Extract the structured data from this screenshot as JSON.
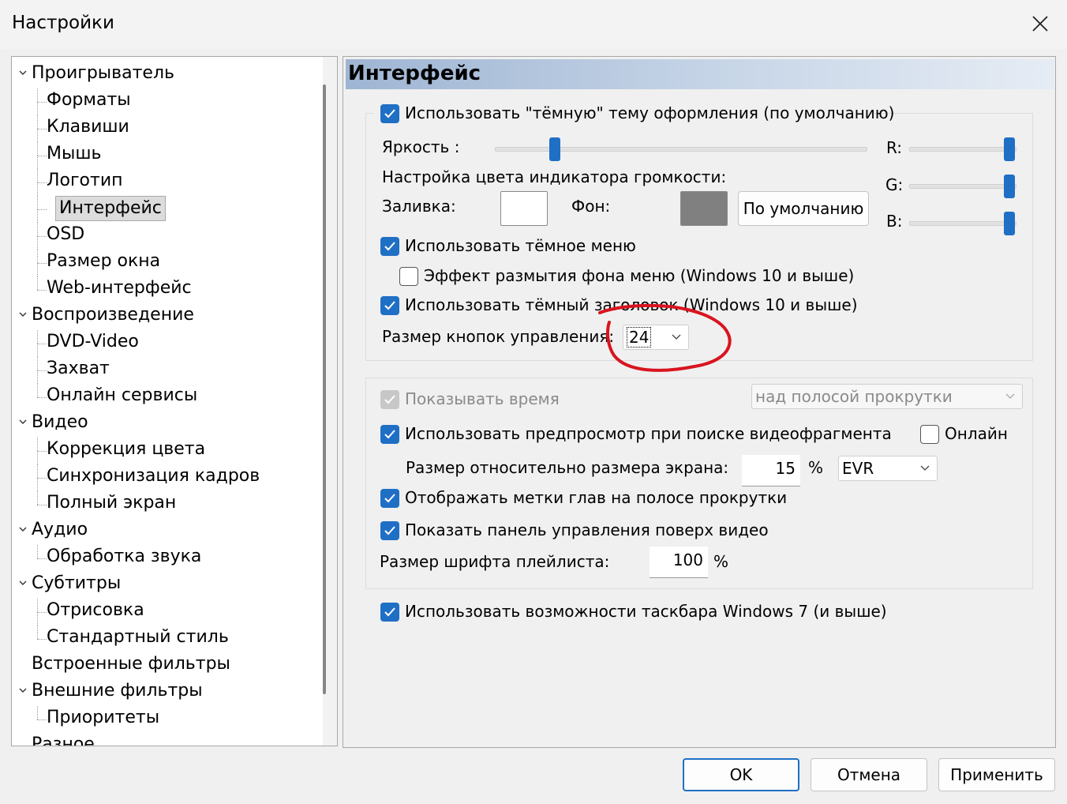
{
  "window": {
    "title": "Настройки"
  },
  "tree": {
    "items": [
      {
        "label": "Проигрыватель"
      },
      {
        "label": "Форматы"
      },
      {
        "label": "Клавиши"
      },
      {
        "label": "Мышь"
      },
      {
        "label": "Логотип"
      },
      {
        "label": "Интерфейс"
      },
      {
        "label": "OSD"
      },
      {
        "label": "Размер окна"
      },
      {
        "label": "Web-интерфейс"
      },
      {
        "label": "Воспроизведение"
      },
      {
        "label": "DVD-Video"
      },
      {
        "label": "Захват"
      },
      {
        "label": "Онлайн сервисы"
      },
      {
        "label": "Видео"
      },
      {
        "label": "Коррекция цвета"
      },
      {
        "label": "Синхронизация кадров"
      },
      {
        "label": "Полный экран"
      },
      {
        "label": "Аудио"
      },
      {
        "label": "Обработка звука"
      },
      {
        "label": "Субтитры"
      },
      {
        "label": "Отрисовка"
      },
      {
        "label": "Стандартный стиль"
      },
      {
        "label": "Встроенные фильтры"
      },
      {
        "label": "Внешние фильтры"
      },
      {
        "label": "Приоритеты"
      },
      {
        "label": "Разное"
      }
    ]
  },
  "page": {
    "header": "Интерфейс",
    "dark_theme": {
      "label": "Использовать \"тёмную\" тему оформления (по умолчанию)",
      "checked": true
    },
    "brightness_label": "Яркость :",
    "rgb": {
      "r": "R:",
      "g": "G:",
      "b": "B:"
    },
    "volume_color_label": "Настройка цвета индикатора громкости:",
    "fill_label": "Заливка:",
    "bg_label": "Фон:",
    "fill_color": "#ffffff",
    "bg_color": "#808080",
    "default_button": "По умолчанию",
    "dark_menu": {
      "label": "Использовать тёмное меню",
      "checked": true
    },
    "blur_menu": {
      "label": "Эффект размытия фона меню (Windows 10 и выше)",
      "checked": false
    },
    "dark_title": {
      "label": "Использовать тёмный заголовок (Windows 10 и выше)",
      "checked": true
    },
    "control_size_label": "Размер кнопок управления:",
    "control_size_value": "24",
    "show_time": {
      "label": "Показывать время",
      "checked": true,
      "disabled": true
    },
    "time_position": "над полосой прокрутки",
    "preview": {
      "label": "Использовать предпросмотр при поиске видеофрагмента",
      "checked": true
    },
    "online": {
      "label": "Онлайн",
      "checked": false
    },
    "preview_size_label": "Размер относительно размера экрана:",
    "preview_size_value": "15",
    "percent": "%",
    "renderer": "EVR",
    "chapter_marks": {
      "label": "Отображать метки глав на полосе прокрутки",
      "checked": true
    },
    "overlay_panel": {
      "label": "Показать панель управления поверх видео",
      "checked": true
    },
    "playlist_font_label": "Размер шрифта плейлиста:",
    "playlist_font_value": "100",
    "taskbar": {
      "label": "Использовать возможности таскбара Windows 7 (и выше)",
      "checked": true
    }
  },
  "buttons": {
    "ok": "OK",
    "cancel": "Отмена",
    "apply": "Применить"
  },
  "colors": {
    "accent": "#1f6fc5",
    "annotation": "#d9141f"
  }
}
